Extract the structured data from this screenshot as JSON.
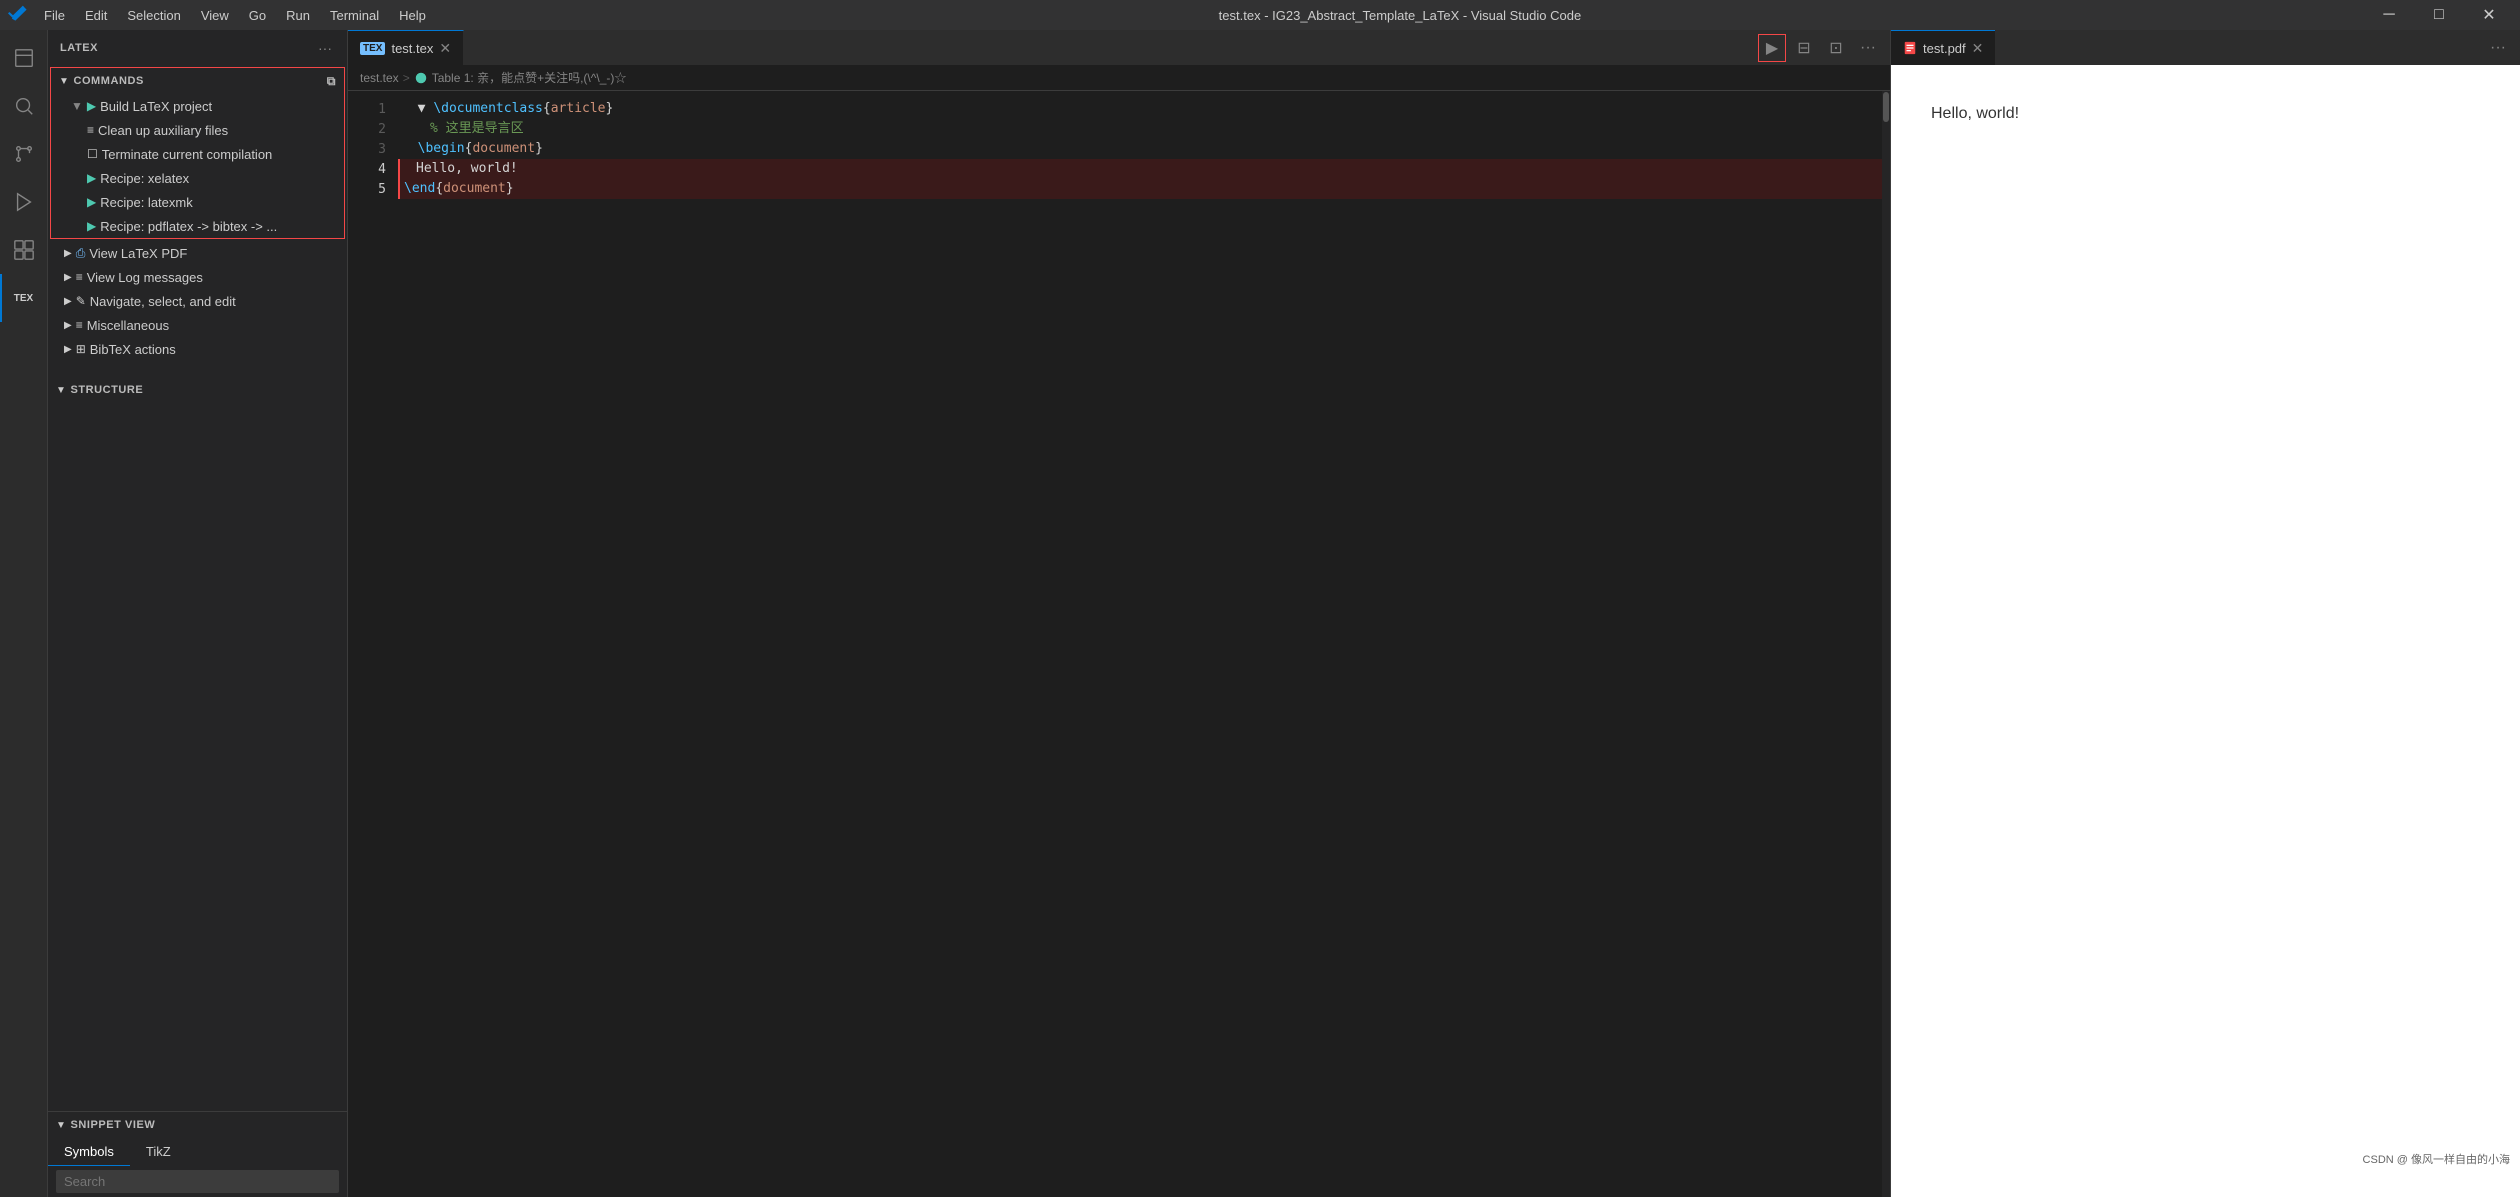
{
  "app": {
    "title": "test.tex - IG23_Abstract_Template_LaTeX - Visual Studio Code"
  },
  "titlebar": {
    "menu": [
      "File",
      "Edit",
      "Selection",
      "View",
      "Go",
      "Run",
      "Terminal",
      "Help"
    ],
    "title": "test.tex - IG23_Abstract_Template_LaTeX - Visual Studio Code",
    "logo": "⬡"
  },
  "sidebar": {
    "header": "LATEX",
    "sections": {
      "commands": {
        "label": "COMMANDS",
        "items": [
          {
            "label": "Build LaTeX project",
            "icon": "▶",
            "indent": 1,
            "expanded": true
          },
          {
            "label": "Clean up auxiliary files",
            "icon": "≡",
            "indent": 2
          },
          {
            "label": "Terminate current compilation",
            "icon": "☐",
            "indent": 2
          },
          {
            "label": "Recipe: xelatex",
            "icon": "▶",
            "indent": 2
          },
          {
            "label": "Recipe: latexmk",
            "icon": "▶",
            "indent": 2
          },
          {
            "label": "Recipe: pdflatex -> bibtex -> ...",
            "icon": "▶",
            "indent": 2
          }
        ]
      },
      "other": [
        {
          "label": "View LaTeX PDF",
          "icon": "⎙",
          "expanded": false
        },
        {
          "label": "View Log messages",
          "icon": "≡",
          "expanded": false
        },
        {
          "label": "Navigate, select, and edit",
          "icon": "✎",
          "expanded": false
        },
        {
          "label": "Miscellaneous",
          "icon": "≡",
          "expanded": false
        },
        {
          "label": "BibTeX actions",
          "icon": "⊞",
          "expanded": false
        }
      ]
    },
    "structure": {
      "label": "STRUCTURE"
    },
    "snippet": {
      "label": "SNIPPET VIEW",
      "tabs": [
        "Symbols",
        "TikZ"
      ],
      "active_tab": "Symbols",
      "search_placeholder": "Search"
    }
  },
  "editor": {
    "tab": {
      "label": "test.tex",
      "icon": "TEX"
    },
    "breadcrumb": [
      "test.tex",
      ">",
      "Table 1: 亲，能点赞+关注吗,(\\^\\_-)☆"
    ],
    "lines": [
      {
        "num": 1,
        "code": "  \\documentclass{article}",
        "highlighted": false
      },
      {
        "num": 2,
        "code": "    % 这里是导言区",
        "highlighted": false
      },
      {
        "num": 3,
        "code": "  \\begin{document}",
        "highlighted": false
      },
      {
        "num": 4,
        "code": "    Hello, world!",
        "highlighted": true
      },
      {
        "num": 5,
        "code": "  \\end{document}",
        "highlighted": true
      }
    ]
  },
  "pdf": {
    "tab_label": "test.pdf",
    "content": "Hello, world!",
    "watermark": "CSDN @ 像风一样自由的小海"
  },
  "activity": {
    "items": [
      {
        "icon": "⬡",
        "name": "vscode-logo"
      },
      {
        "icon": "🔍",
        "name": "search"
      },
      {
        "icon": "⎇",
        "name": "source-control"
      },
      {
        "icon": "▷",
        "name": "run-debug"
      },
      {
        "icon": "⊞",
        "name": "extensions"
      },
      {
        "icon": "TEX",
        "name": "latex-workshop",
        "active": true
      }
    ]
  }
}
